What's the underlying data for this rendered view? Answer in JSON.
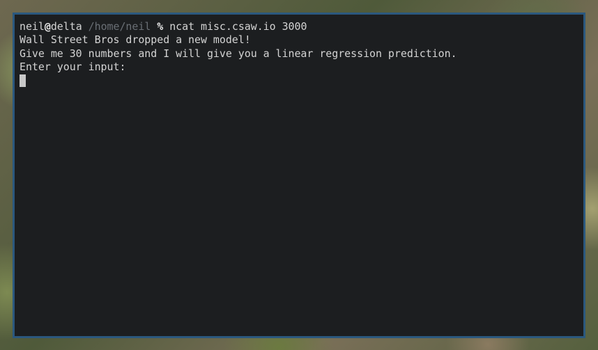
{
  "terminal": {
    "prompt": {
      "user": "neil",
      "at": "@",
      "host": "delta",
      "cwd": "/home/neil",
      "symbol": "%",
      "command": "ncat misc.csaw.io 3000"
    },
    "output": [
      "Wall Street Bros dropped a new model!",
      "Give me 30 numbers and I will give you a linear regression prediction.",
      "Enter your input:"
    ],
    "colors": {
      "background": "#1c1e20",
      "border": "#2b587e",
      "text": "#d4d4d4",
      "cwd": "#6a6f75"
    }
  }
}
